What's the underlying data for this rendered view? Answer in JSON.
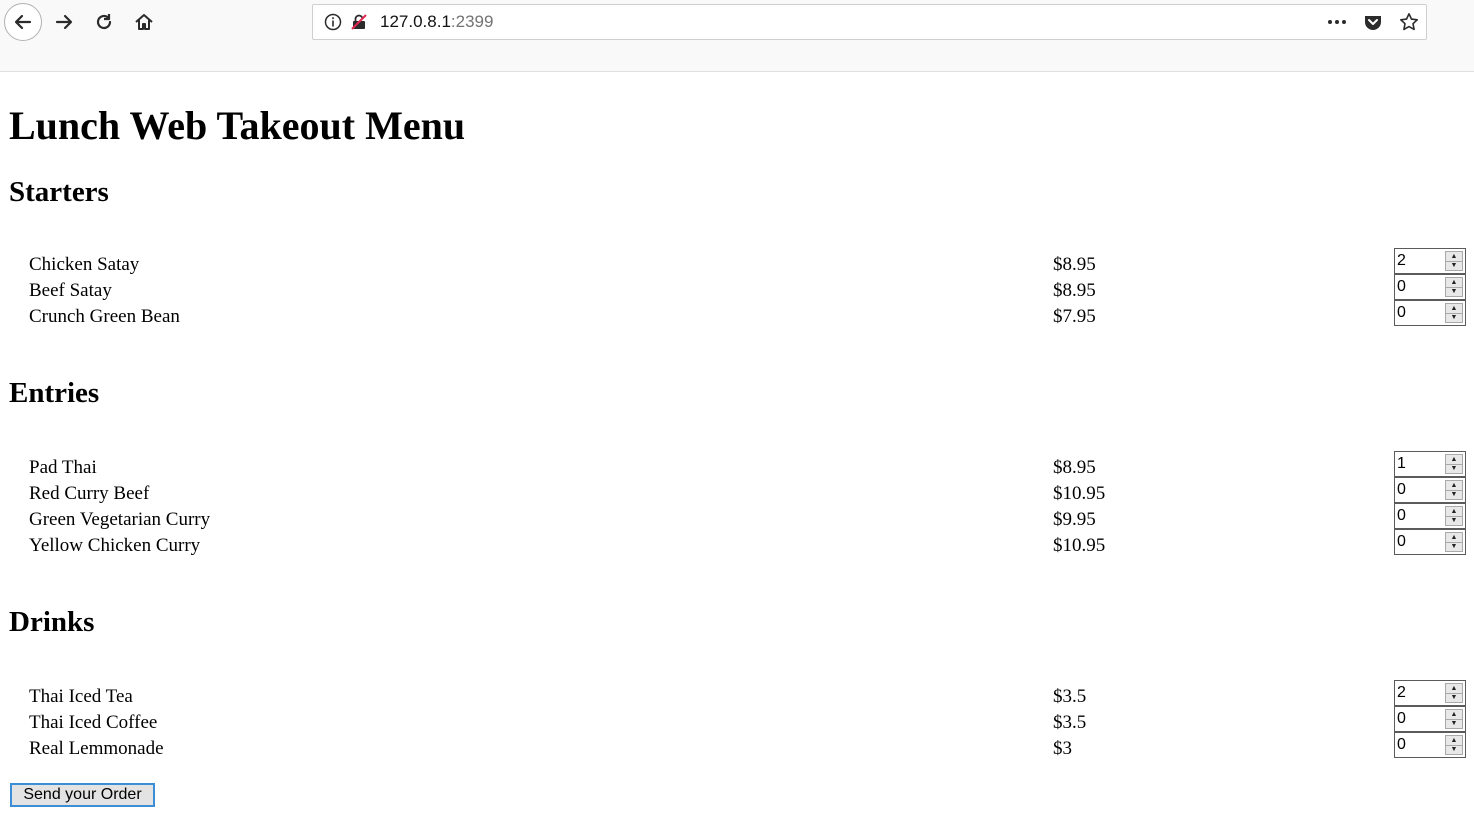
{
  "browser": {
    "url_host": "127.0.8.1",
    "url_port": ":2399",
    "icons": [
      "back-arrow-icon",
      "forward-arrow-icon",
      "reload-icon",
      "home-icon",
      "info-icon",
      "insecure-lock-icon",
      "more-icon",
      "pocket-icon",
      "star-icon"
    ]
  },
  "page": {
    "title": "Lunch Web Takeout Menu",
    "sections": [
      {
        "heading": "Starters",
        "items": [
          {
            "name": "Chicken Satay",
            "price": "$8.95",
            "qty": "2"
          },
          {
            "name": "Beef Satay",
            "price": "$8.95",
            "qty": "0"
          },
          {
            "name": "Crunch Green Bean",
            "price": "$7.95",
            "qty": "0"
          }
        ]
      },
      {
        "heading": "Entries",
        "items": [
          {
            "name": "Pad Thai",
            "price": "$8.95",
            "qty": "1"
          },
          {
            "name": "Red Curry Beef",
            "price": "$10.95",
            "qty": "0"
          },
          {
            "name": "Green Vegetarian Curry",
            "price": "$9.95",
            "qty": "0"
          },
          {
            "name": "Yellow Chicken Curry",
            "price": "$10.95",
            "qty": "0"
          }
        ]
      },
      {
        "heading": "Drinks",
        "items": [
          {
            "name": "Thai Iced Tea",
            "price": "$3.5",
            "qty": "2"
          },
          {
            "name": "Thai Iced Coffee",
            "price": "$3.5",
            "qty": "0"
          },
          {
            "name": "Real Lemmonade",
            "price": "$3",
            "qty": "0"
          }
        ]
      }
    ],
    "submit_label": "Send your Order"
  }
}
